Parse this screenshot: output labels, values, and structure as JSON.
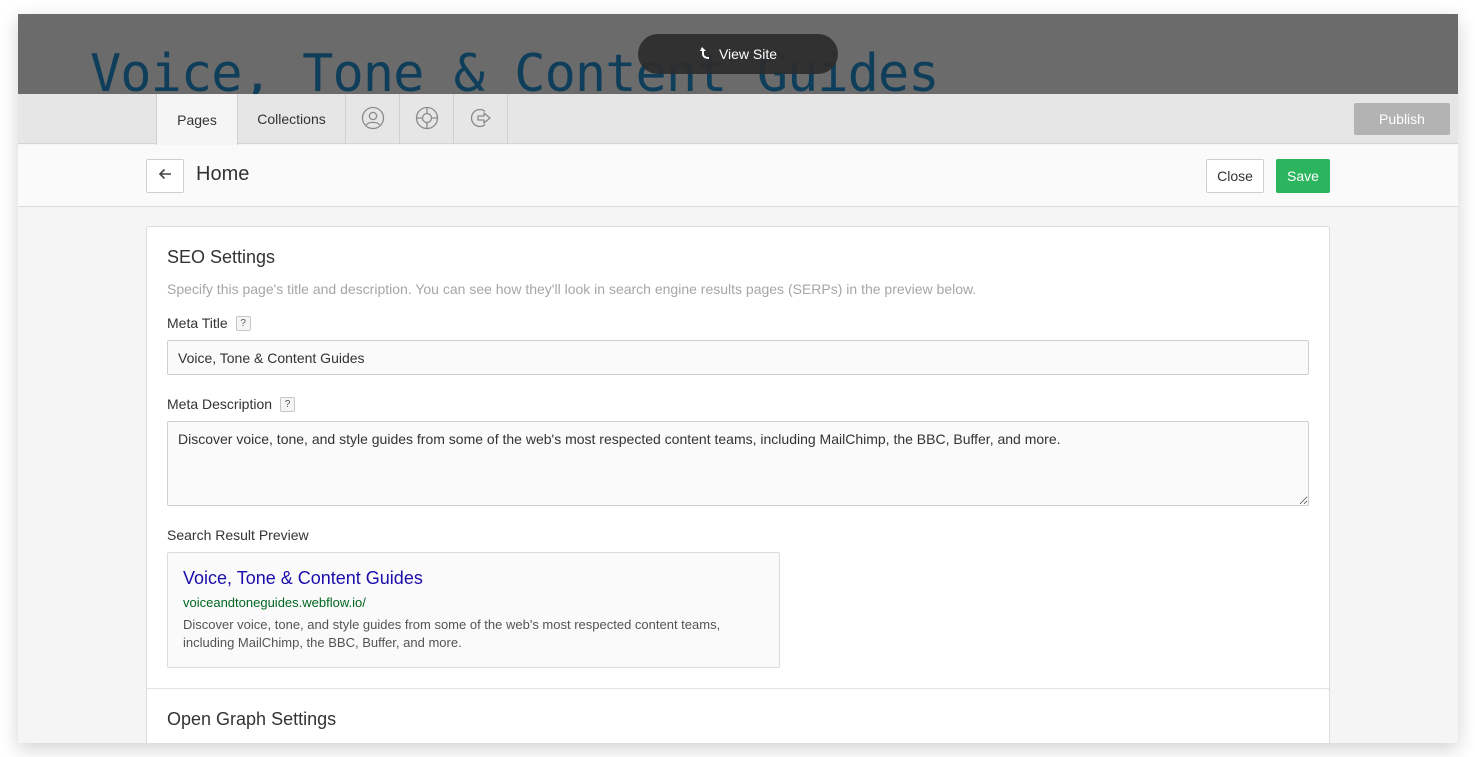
{
  "site": {
    "heading": "Voice, Tone & Content Guides",
    "view_site_label": "View Site"
  },
  "toolbar": {
    "tabs": [
      {
        "label": "Pages",
        "active": true
      },
      {
        "label": "Collections",
        "active": false
      }
    ],
    "icon_tabs": [
      "user-icon",
      "lifebuoy-icon",
      "logout-icon"
    ],
    "publish_label": "Publish"
  },
  "header": {
    "page_name": "Home",
    "close_label": "Close",
    "save_label": "Save"
  },
  "seo": {
    "title": "SEO Settings",
    "description": "Specify this page's title and description. You can see how they'll look in search engine results pages (SERPs) in the preview below.",
    "meta_title_label": "Meta Title",
    "meta_title_value": "Voice, Tone & Content Guides",
    "meta_description_label": "Meta Description",
    "meta_description_value": "Discover voice, tone, and style guides from some of the web's most respected content teams, including MailChimp, the BBC, Buffer, and more.",
    "help_glyph": "?",
    "preview_label": "Search Result Preview",
    "preview": {
      "title": "Voice, Tone & Content Guides",
      "url": "voiceandtoneguides.webflow.io/",
      "description": "Discover voice, tone, and style guides from some of the web's most respected content teams, including MailChimp, the BBC, Buffer, and more."
    }
  },
  "open_graph": {
    "title": "Open Graph Settings"
  },
  "colors": {
    "save": "#2bb55e",
    "publish_disabled": "#b3b3b3",
    "preview_title": "#1a0dab",
    "preview_url": "#006621"
  }
}
